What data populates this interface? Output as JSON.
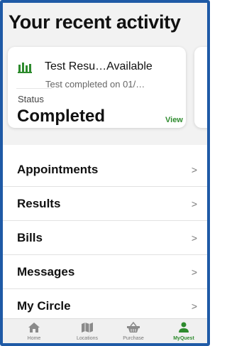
{
  "header": {
    "title": "Your recent activity"
  },
  "activity_card": {
    "icon": "bar-chart-icon",
    "title": "Test Resu…Available",
    "subtitle": "Test completed on 01/…",
    "status_label": "Status",
    "status_value": "Completed",
    "action_label": "View"
  },
  "menu": {
    "items": [
      {
        "label": "Appointments",
        "icon": "chevron-right-icon"
      },
      {
        "label": "Results",
        "icon": "chevron-right-icon"
      },
      {
        "label": "Bills",
        "icon": "chevron-right-icon"
      },
      {
        "label": "Messages",
        "icon": "chevron-right-icon"
      },
      {
        "label": "My Circle",
        "icon": "chevron-right-icon"
      }
    ]
  },
  "tabbar": {
    "tabs": [
      {
        "label": "Home",
        "icon": "home-icon"
      },
      {
        "label": "Locations",
        "icon": "map-icon"
      },
      {
        "label": "Purchase",
        "icon": "basket-icon"
      },
      {
        "label": "MyQuest",
        "icon": "person-icon",
        "active": true
      }
    ]
  },
  "colors": {
    "accent": "#2e8b2e",
    "frame": "#1f5aa6"
  }
}
